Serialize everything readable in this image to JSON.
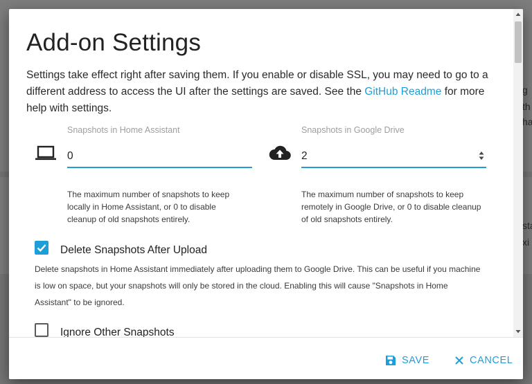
{
  "background": {
    "fragments": [
      "g",
      "th",
      "ha",
      "sta",
      "xi"
    ]
  },
  "dialog": {
    "title": "Add-on Settings",
    "intro_before_link": "Settings take effect right after saving them. If you enable or disable SSL, you may need to go to a different address to access the UI after the settings are saved. See the ",
    "intro_link": "GitHub Readme",
    "intro_after_link": " for more help with settings."
  },
  "fields": {
    "ha_snapshots": {
      "label": "Snapshots in Home Assistant",
      "value": "0",
      "icon": "laptop-icon",
      "help": "The maximum number of snapshots to keep locally in Home Assistant, or 0 to disable cleanup of old snapshots entirely."
    },
    "drive_snapshots": {
      "label": "Snapshots in Google Drive",
      "value": "2",
      "icon": "cloud-upload-icon",
      "help": "The maximum number of snapshots to keep remotely in Google Drive, or 0 to disable cleanup of old snapshots entirely."
    }
  },
  "options": {
    "delete_after_upload": {
      "label": "Delete Snapshots After Upload",
      "checked": true,
      "description": "Delete snapshots in Home Assistant immediately after uploading them to Google Drive. This can be useful if you machine is low on space, but your snapshots will only be stored in the cloud. Enabling this will cause \"Snapshots in Home Assistant\" to be ignored."
    },
    "ignore_other": {
      "label": "Ignore Other Snapshots",
      "checked": false
    }
  },
  "footer": {
    "save_label": "SAVE",
    "cancel_label": "CANCEL"
  },
  "colors": {
    "accent": "#1e9ed8",
    "text": "#222222",
    "muted": "#9e9e9e"
  }
}
